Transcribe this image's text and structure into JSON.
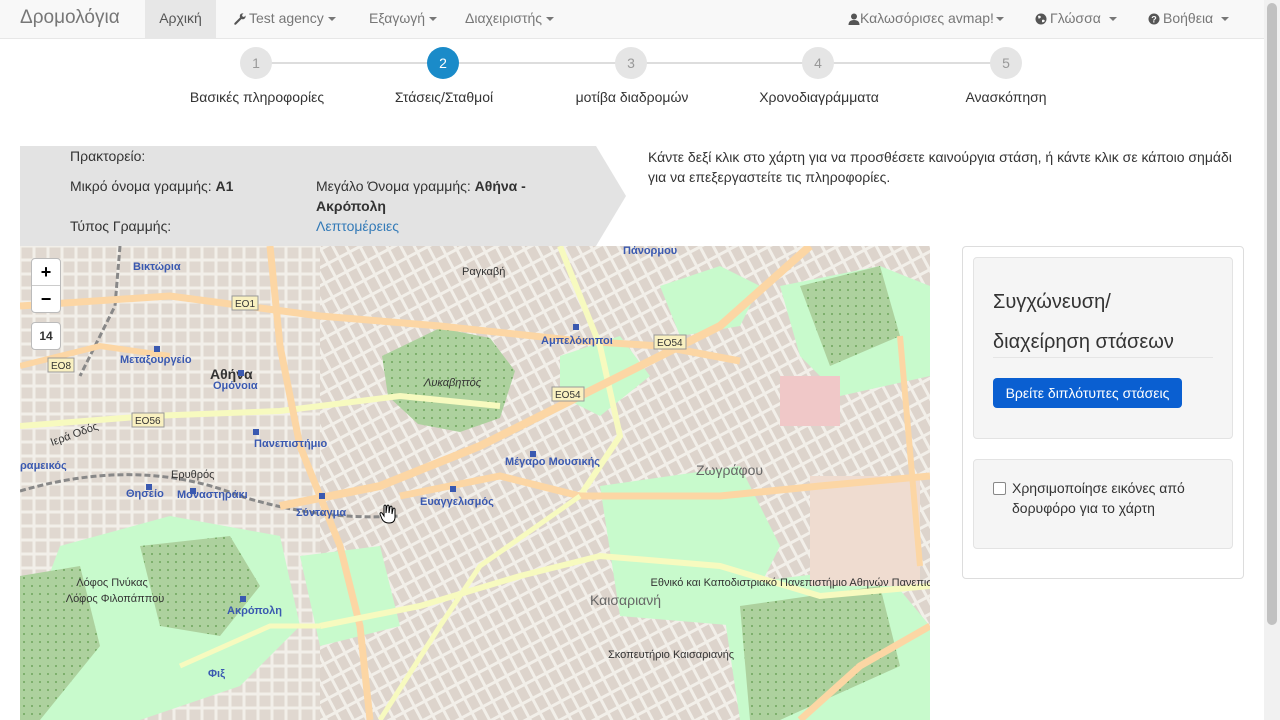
{
  "navbar": {
    "brand": "Δρομολόγια",
    "home": "Αρχική",
    "agency": "Test agency",
    "export": "Εξαγωγή",
    "admin": "Διαχειριστής",
    "user": "Καλωσόρισες avmap!",
    "language": "Γλώσσα",
    "help": "Βοήθεια"
  },
  "wizard": {
    "steps": [
      {
        "number": "1",
        "label": "Βασικές πληροφορίες"
      },
      {
        "number": "2",
        "label": "Στάσεις/Σταθμοί"
      },
      {
        "number": "3",
        "label": "μοτίβα διαδρομών"
      },
      {
        "number": "4",
        "label": "Χρονοδιαγράμματα"
      },
      {
        "number": "5",
        "label": "Ανασκόπηση"
      }
    ],
    "active_step": 2
  },
  "route_info": {
    "agency_label": "Πρακτορείο:",
    "short_name_label": "Μικρό όνομα γραμμής:",
    "short_name_value": "A1",
    "long_name_label": "Μεγάλο Όνομα γραμμής:",
    "long_name_value_line1": "Αθήνα -",
    "long_name_value_line2": "Ακρόπολη",
    "type_label": "Τύπος Γραμμής:",
    "details_link": "Λεπτομέρειες"
  },
  "help_text": "Κάντε δεξί κλικ στο χάρτη για να προσθέσετε καινούργια στάση, ή κάντε κλικ σε κάποιο σημάδι για να επεξεργαστείτε τις πληροφορίες.",
  "map": {
    "zoom_in": "+",
    "zoom_out": "−",
    "zoom_level": "14",
    "labels": {
      "athina": "Αθήνα",
      "omonoia": "Ομόνοια",
      "metaxourgeio": "Μεταξουργείο",
      "panepistimio": "Πανεπιστήμιο",
      "syntagma": "Σύνταγμα",
      "thiseio": "Θησείο",
      "monastiraki": "Μοναστηράκι",
      "akropoli": "Ακρόπολη",
      "lykavittos": "Λυκαβηττός",
      "ampelokipoi": "Αμπελόκηποι",
      "evangelismos": "Ευαγγελισμός",
      "megaro": "Μέγαρο Μουσικής",
      "zografou": "Ζωγράφου",
      "kaisariani": "Καισαριανή",
      "viktoria": "Βικτώρια",
      "panormou": "Πάνορμου",
      "panepistimiopoli": "Εθνικό και Καποδιστριακό Πανεπιστήμιο Αθηνών Πανεπιστημιούπολη",
      "filopappou": "Λόφος Φιλοπάππου",
      "pnykas": "Λόφος Πνύκας",
      "keramikos": "ραμεικός",
      "fix": "Φιξ",
      "eo1": "EO1",
      "eo8": "EO8",
      "eo56": "EO56",
      "eo54a": "EO54",
      "eo54b": "EO54",
      "erythros": "Ερυθρός",
      "iera": "Ιερά Οδός",
      "raykavi": "Ραγκαβή",
      "skopeftirio": "Σκοπευτήριο Καισαριανής"
    },
    "colors": {
      "background": "#f2efe9",
      "major_road": "#fcd6a4",
      "primary_road": "#f7fabf",
      "park": "#c8facc",
      "forest": "#add19e",
      "building": "#d9d0c9",
      "metro_label": "#3a59b0"
    }
  },
  "stop_panel": {
    "title": "Συγχώνευση/ διαχείρηση στάσεων",
    "find_duplicates_button": "Βρείτε διπλότυπες στάσεις",
    "satellite_checkbox_label": "Χρησιμοποίησε εικόνες από δορυφόρο για το χάρτη",
    "satellite_checked": false
  }
}
